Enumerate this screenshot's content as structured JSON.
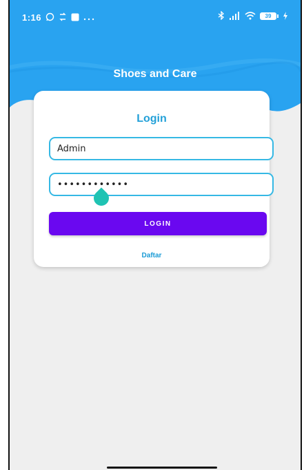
{
  "status_bar": {
    "time": "1:16",
    "battery": "39"
  },
  "app": {
    "title": "Shoes and Care"
  },
  "login_card": {
    "title": "Login",
    "username_value": "Admin",
    "password_value": "••••••••••••",
    "login_button": "LOGIN",
    "register_link": "Daftar"
  },
  "colors": {
    "header_blue": "#29a3f0",
    "title_blue": "#22a0d8",
    "field_border": "#35b8e4",
    "button_purple": "#6a08f0",
    "background": "#efefef"
  }
}
